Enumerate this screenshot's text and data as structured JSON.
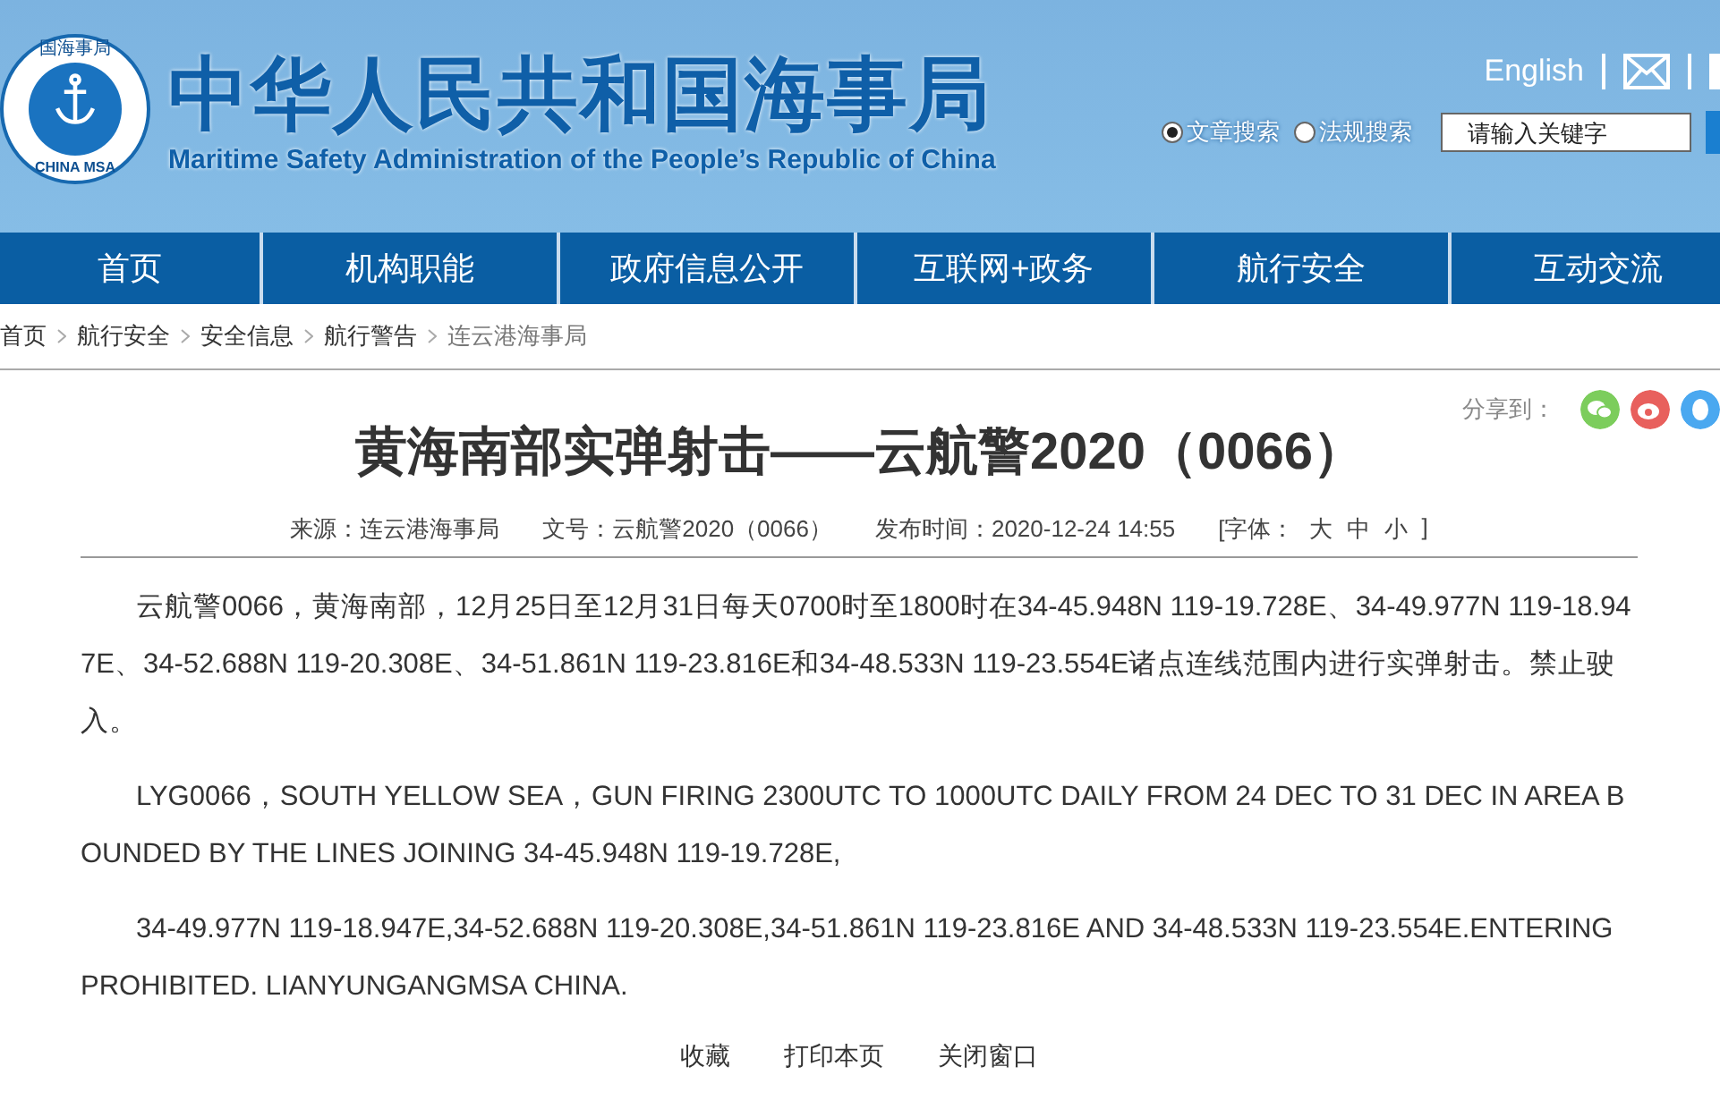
{
  "header": {
    "logo_text": "CHINA MSA",
    "logo_top_text": "国海事局",
    "title": "中华人民共和国海事局",
    "subtitle": "Maritime Safety Administration of the People’s Republic of China",
    "language_link": "English"
  },
  "search": {
    "options": [
      {
        "label": "文章搜索",
        "selected": true
      },
      {
        "label": "法规搜索",
        "selected": false
      }
    ],
    "placeholder": "请输入关键字"
  },
  "nav": [
    "首页",
    "机构职能",
    "政府信息公开",
    "互联网+政务",
    "航行安全",
    "互动交流"
  ],
  "breadcrumb": [
    "首页",
    "航行安全",
    "安全信息",
    "航行警告",
    "连云港海事局"
  ],
  "share": {
    "label": "分享到："
  },
  "article": {
    "title": "黄海南部实弹射击——云航警2020（0066）",
    "meta": [
      "来源：连云港海事局",
      "文号：云航警2020（0066）",
      "发布时间：2020-12-24 14:55"
    ],
    "font_size": {
      "label": "[字体：",
      "options": [
        "大",
        "中",
        "小"
      ],
      "end": "]"
    },
    "paragraphs": [
      "云航警0066，黄海南部，12月25日至12月31日每天0700时至1800时在34-45.948N 119-19.728E、34-49.977N 119-18.947E、34-52.688N 119-20.308E、34-51.861N 119-23.816E和34-48.533N 119-23.554E诸点连线范围内进行实弹射击。禁止驶入。",
      "LYG0066，SOUTH YELLOW SEA，GUN FIRING 2300UTC TO 1000UTC DAILY FROM 24 DEC TO 31 DEC IN AREA BOUNDED BY THE LINES JOINING 34-45.948N 119-19.728E,",
      "34-49.977N 119-18.947E,34-52.688N 119-20.308E,34-51.861N 119-23.816E AND 34-48.533N 119-23.554E.ENTERING PROHIBITED. LIANYUNGANGMSA CHINA."
    ],
    "actions": [
      "收藏",
      "打印本页",
      "关闭窗口"
    ]
  }
}
